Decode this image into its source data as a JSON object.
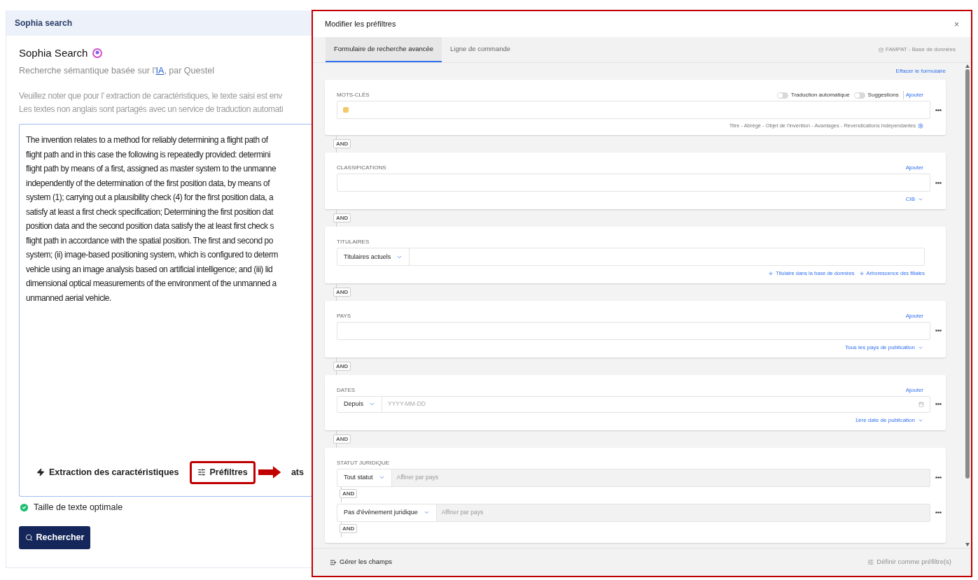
{
  "panel": {
    "header": "Sophia search",
    "title": "Sophia Search",
    "subtitle_parts": [
      "Recherche sémantique basée sur l'",
      "IA",
      ", par Questel"
    ],
    "notice": [
      "Veuillez noter que pour l’   extraction de caractéristiques, le texte saisi est env",
      "Les textes non anglais sont partagés avec un service de traduction automati"
    ],
    "text_lines": [
      "The invention relates to a method for reliably determining a flight path of",
      "flight path and in this case the following is repeatedly provided: determini",
      "flight path by means of a first, assigned as master system to the unmanne",
      "independently of the determination of the first position data, by means of",
      "system (1); carrying out a plausibility check (4) for the first position data, a",
      "satisfy at least a first check specification; Determining the first position dat",
      "position data and the second position data satisfy the at least first check s",
      "flight path in accordance with the spatial position. The first and second po",
      "system; (ii) image-based positioning system, which is configured to determ",
      "vehicle using an image analysis based on artificial intelligence; and (iii) lid",
      "dimensional optical measurements of the environment of the unmanned a",
      "unmanned aerial vehicle."
    ],
    "actions": [
      {
        "kind": "extract",
        "label": "Extraction des caractéristiques",
        "highlighted": false
      },
      {
        "kind": "prefilter",
        "label": "Préfiltres",
        "highlighted": true
      },
      {
        "kind": "cut",
        "label": "ats",
        "highlighted": false
      }
    ],
    "status": "Taille de texte optimale",
    "search_button": "Rechercher"
  },
  "modal": {
    "title": "Modifier les préfiltres",
    "close": "×",
    "tabs": [
      {
        "label": "Formulaire de recherche avancée",
        "selected": true
      },
      {
        "label": "Ligne de commande",
        "selected": false
      }
    ],
    "database": "FAMPAT - Base de données",
    "clear": "Effacer le formulaire",
    "sections": [
      {
        "kind": "keywords",
        "label": "MOTS-CLÉS",
        "toggles": [
          {
            "label": "Traduction automatique",
            "on": false
          },
          {
            "label": "Suggestions",
            "on": false
          }
        ],
        "add": "Ajouter",
        "hint": "Titre - Abrégé - Objet de l'invention - Avantages - Revendications indépendantes",
        "connector": "AND"
      },
      {
        "kind": "plain",
        "label": "CLASSIFICATIONS",
        "add": "Ajouter",
        "link": "CIB",
        "connector": "AND"
      },
      {
        "kind": "holders",
        "label": "TITULAIRES",
        "select": "Titulaires actuels",
        "links": [
          "Titulaire dans la base de données",
          "Arborescence des filiales"
        ],
        "connector": "AND"
      },
      {
        "kind": "plain",
        "label": "PAYS",
        "add": "Ajouter",
        "link": "Tous les pays de publication",
        "connector": "AND"
      },
      {
        "kind": "dates",
        "label": "DATES",
        "add": "Ajouter",
        "select": "Depuis",
        "placeholder": "YYYY-MM-DD",
        "link": "1ère date de publication",
        "connector": "AND"
      },
      {
        "kind": "legal",
        "label": "STATUT JURIDIQUE",
        "rows": [
          {
            "select": "Tout statut",
            "placeholder": "Affiner par pays",
            "connector": "AND"
          },
          {
            "select": "Pas d'évènement juridique",
            "placeholder": "Affiner par pays",
            "connector": "AND"
          }
        ]
      }
    ],
    "footer_left": "Gérer les champs",
    "footer_right": "Définir comme préfiltre(s)"
  }
}
